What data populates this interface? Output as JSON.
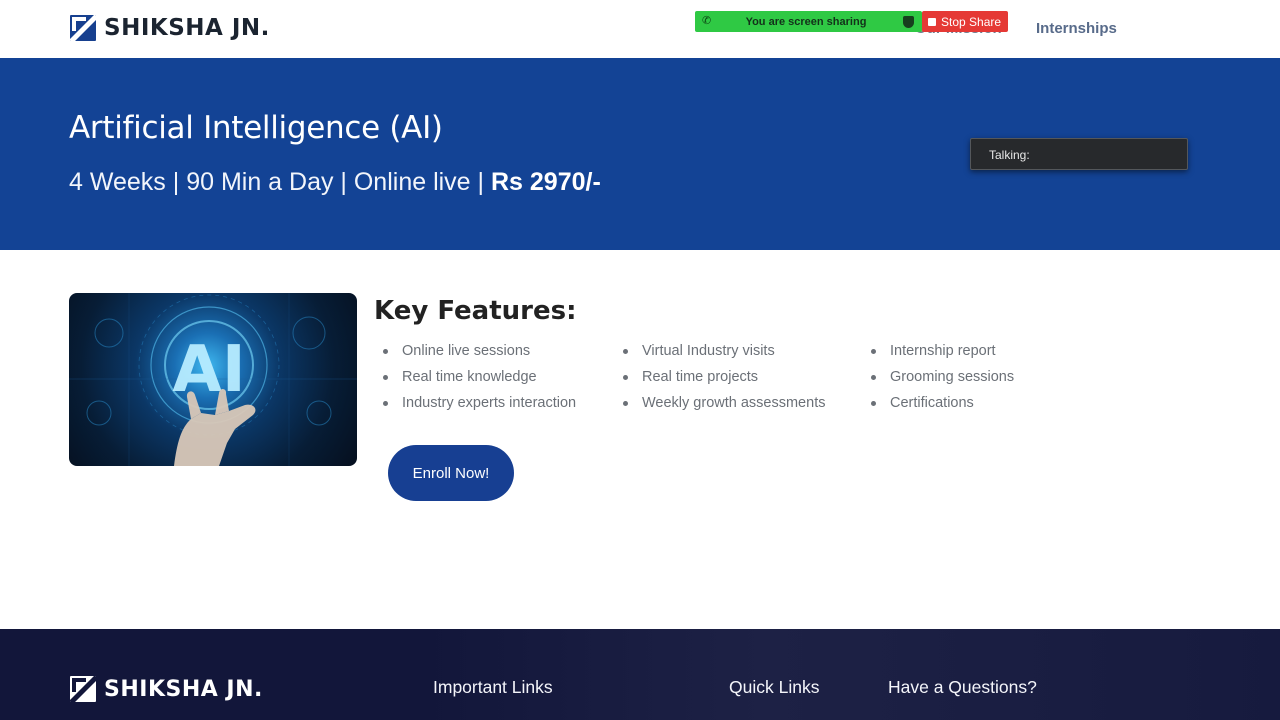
{
  "header": {
    "brand": "SHIKSHA JN.",
    "nav": {
      "our_mission": "Our Mission",
      "internships": "Internships"
    }
  },
  "screen_share": {
    "status": "You are screen sharing",
    "stop_label": "Stop Share",
    "talking_label": "Talking:",
    "colors": {
      "bar": "#2fc944",
      "stop": "#e53935"
    }
  },
  "hero": {
    "title": "Artificial Intelligence (AI)",
    "subtitle_plain": "4 Weeks | 90 Min a Day | Online live | ",
    "price": "Rs 2970/-"
  },
  "features": {
    "heading": "Key Features:",
    "col1": [
      "Online live sessions",
      "Real time knowledge",
      "Industry experts interaction"
    ],
    "col2": [
      "Virtual Industry visits",
      "Real time projects",
      "Weekly growth assessments"
    ],
    "col3": [
      "Internship report",
      "Grooming sessions",
      "Certifications"
    ],
    "image_icon": "ai-hand-hologram-image",
    "image_text": "AI"
  },
  "cta": {
    "enroll_label": "Enroll Now!"
  },
  "footer": {
    "brand": "SHIKSHA JN.",
    "important_links": "Important Links",
    "quick_links": "Quick Links",
    "questions": "Have a Questions?"
  },
  "colors": {
    "brand_blue": "#134395",
    "footer_bg": "#12163a"
  }
}
